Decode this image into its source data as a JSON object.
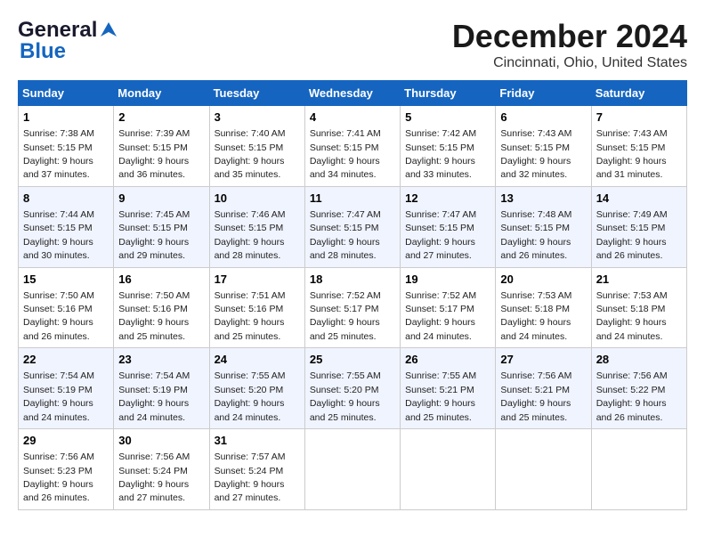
{
  "logo": {
    "line1": "General",
    "line2": "Blue"
  },
  "title": "December 2024",
  "subtitle": "Cincinnati, Ohio, United States",
  "weekdays": [
    "Sunday",
    "Monday",
    "Tuesday",
    "Wednesday",
    "Thursday",
    "Friday",
    "Saturday"
  ],
  "weeks": [
    [
      {
        "day": 1,
        "sunrise": "7:38 AM",
        "sunset": "5:15 PM",
        "daylight": "9 hours and 37 minutes."
      },
      {
        "day": 2,
        "sunrise": "7:39 AM",
        "sunset": "5:15 PM",
        "daylight": "9 hours and 36 minutes."
      },
      {
        "day": 3,
        "sunrise": "7:40 AM",
        "sunset": "5:15 PM",
        "daylight": "9 hours and 35 minutes."
      },
      {
        "day": 4,
        "sunrise": "7:41 AM",
        "sunset": "5:15 PM",
        "daylight": "9 hours and 34 minutes."
      },
      {
        "day": 5,
        "sunrise": "7:42 AM",
        "sunset": "5:15 PM",
        "daylight": "9 hours and 33 minutes."
      },
      {
        "day": 6,
        "sunrise": "7:43 AM",
        "sunset": "5:15 PM",
        "daylight": "9 hours and 32 minutes."
      },
      {
        "day": 7,
        "sunrise": "7:43 AM",
        "sunset": "5:15 PM",
        "daylight": "9 hours and 31 minutes."
      }
    ],
    [
      {
        "day": 8,
        "sunrise": "7:44 AM",
        "sunset": "5:15 PM",
        "daylight": "9 hours and 30 minutes."
      },
      {
        "day": 9,
        "sunrise": "7:45 AM",
        "sunset": "5:15 PM",
        "daylight": "9 hours and 29 minutes."
      },
      {
        "day": 10,
        "sunrise": "7:46 AM",
        "sunset": "5:15 PM",
        "daylight": "9 hours and 28 minutes."
      },
      {
        "day": 11,
        "sunrise": "7:47 AM",
        "sunset": "5:15 PM",
        "daylight": "9 hours and 28 minutes."
      },
      {
        "day": 12,
        "sunrise": "7:47 AM",
        "sunset": "5:15 PM",
        "daylight": "9 hours and 27 minutes."
      },
      {
        "day": 13,
        "sunrise": "7:48 AM",
        "sunset": "5:15 PM",
        "daylight": "9 hours and 26 minutes."
      },
      {
        "day": 14,
        "sunrise": "7:49 AM",
        "sunset": "5:15 PM",
        "daylight": "9 hours and 26 minutes."
      }
    ],
    [
      {
        "day": 15,
        "sunrise": "7:50 AM",
        "sunset": "5:16 PM",
        "daylight": "9 hours and 26 minutes."
      },
      {
        "day": 16,
        "sunrise": "7:50 AM",
        "sunset": "5:16 PM",
        "daylight": "9 hours and 25 minutes."
      },
      {
        "day": 17,
        "sunrise": "7:51 AM",
        "sunset": "5:16 PM",
        "daylight": "9 hours and 25 minutes."
      },
      {
        "day": 18,
        "sunrise": "7:52 AM",
        "sunset": "5:17 PM",
        "daylight": "9 hours and 25 minutes."
      },
      {
        "day": 19,
        "sunrise": "7:52 AM",
        "sunset": "5:17 PM",
        "daylight": "9 hours and 24 minutes."
      },
      {
        "day": 20,
        "sunrise": "7:53 AM",
        "sunset": "5:18 PM",
        "daylight": "9 hours and 24 minutes."
      },
      {
        "day": 21,
        "sunrise": "7:53 AM",
        "sunset": "5:18 PM",
        "daylight": "9 hours and 24 minutes."
      }
    ],
    [
      {
        "day": 22,
        "sunrise": "7:54 AM",
        "sunset": "5:19 PM",
        "daylight": "9 hours and 24 minutes."
      },
      {
        "day": 23,
        "sunrise": "7:54 AM",
        "sunset": "5:19 PM",
        "daylight": "9 hours and 24 minutes."
      },
      {
        "day": 24,
        "sunrise": "7:55 AM",
        "sunset": "5:20 PM",
        "daylight": "9 hours and 24 minutes."
      },
      {
        "day": 25,
        "sunrise": "7:55 AM",
        "sunset": "5:20 PM",
        "daylight": "9 hours and 25 minutes."
      },
      {
        "day": 26,
        "sunrise": "7:55 AM",
        "sunset": "5:21 PM",
        "daylight": "9 hours and 25 minutes."
      },
      {
        "day": 27,
        "sunrise": "7:56 AM",
        "sunset": "5:21 PM",
        "daylight": "9 hours and 25 minutes."
      },
      {
        "day": 28,
        "sunrise": "7:56 AM",
        "sunset": "5:22 PM",
        "daylight": "9 hours and 26 minutes."
      }
    ],
    [
      {
        "day": 29,
        "sunrise": "7:56 AM",
        "sunset": "5:23 PM",
        "daylight": "9 hours and 26 minutes."
      },
      {
        "day": 30,
        "sunrise": "7:56 AM",
        "sunset": "5:24 PM",
        "daylight": "9 hours and 27 minutes."
      },
      {
        "day": 31,
        "sunrise": "7:57 AM",
        "sunset": "5:24 PM",
        "daylight": "9 hours and 27 minutes."
      },
      null,
      null,
      null,
      null
    ]
  ]
}
